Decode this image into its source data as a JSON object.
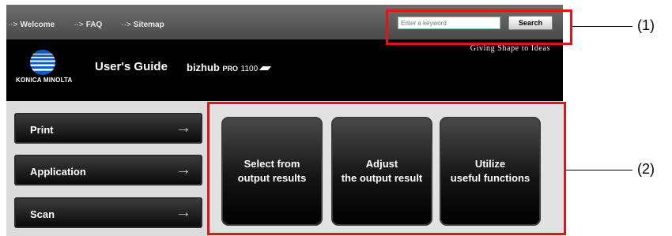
{
  "top_nav": {
    "arrow_glyph": "··>",
    "links": [
      {
        "label": "Welcome"
      },
      {
        "label": "FAQ"
      },
      {
        "label": "Sitemap"
      }
    ]
  },
  "search": {
    "placeholder": "Enter a keyword",
    "button_label": "Search"
  },
  "header": {
    "tagline": "Giving Shape to Ideas",
    "logo_text": "KONICA MINOLTA",
    "title": "User's Guide",
    "product_name": "bizhub",
    "product_model": "PRO",
    "product_number": "1100"
  },
  "sidebar": {
    "arrow_glyph": "→",
    "items": [
      {
        "label": "Print"
      },
      {
        "label": "Application"
      },
      {
        "label": "Scan"
      }
    ]
  },
  "main_buttons": [
    {
      "line1": "Select from",
      "line2": "output results"
    },
    {
      "line1": "Adjust",
      "line2": "the output result"
    },
    {
      "line1": "Utilize",
      "line2": "useful functions"
    }
  ],
  "callouts": [
    {
      "label": "(1)"
    },
    {
      "label": "(2)"
    }
  ],
  "colors": {
    "highlight_red": "#e0141c",
    "header_black": "#000000",
    "search_border": "#7ec39a"
  }
}
